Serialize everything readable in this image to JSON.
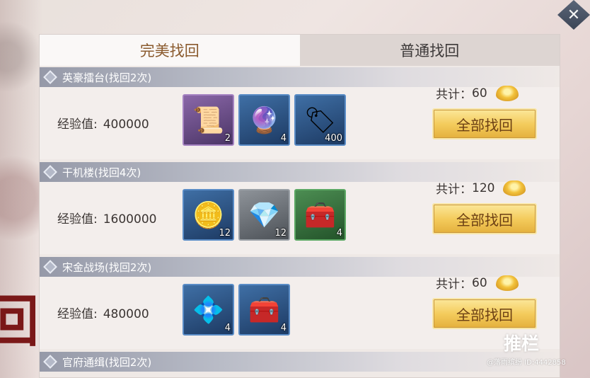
{
  "background_char": "回",
  "tabs": [
    {
      "label": "完美找回",
      "active": true
    },
    {
      "label": "普通找回",
      "active": false
    }
  ],
  "exp_label": "经验值:",
  "total_label": "共计：",
  "recover_button_label": "全部找回",
  "sections": [
    {
      "title": "英豪擂台",
      "count": "(找回2次)",
      "exp": "400000",
      "total": "60",
      "items": [
        {
          "icon": "scroll-icon",
          "glyph": "📜",
          "qty": "2",
          "rarity": "purple"
        },
        {
          "icon": "crystal-ball-icon",
          "glyph": "🔮",
          "qty": "4",
          "rarity": "blue"
        },
        {
          "icon": "token-icon",
          "glyph": "🏷",
          "qty": "400",
          "rarity": "blue"
        }
      ]
    },
    {
      "title": "干机楼",
      "count": "(找回4次)",
      "exp": "1600000",
      "total": "120",
      "items": [
        {
          "icon": "silver-ingot-icon",
          "glyph": "🪙",
          "qty": "12",
          "rarity": "blue"
        },
        {
          "icon": "crystal-shard-icon",
          "glyph": "💎",
          "qty": "12",
          "rarity": "gray"
        },
        {
          "icon": "treasure-chest-icon",
          "glyph": "🧰",
          "qty": "4",
          "rarity": "green"
        }
      ]
    },
    {
      "title": "宋金战场",
      "count": "(找回2次)",
      "exp": "480000",
      "total": "60",
      "items": [
        {
          "icon": "blue-gem-icon",
          "glyph": "💠",
          "qty": "4",
          "rarity": "blue"
        },
        {
          "icon": "jade-chest-icon",
          "glyph": "🧰",
          "qty": "4",
          "rarity": "blue"
        }
      ]
    },
    {
      "title": "官府通缉",
      "count": "(找回2次)"
    }
  ],
  "watermark": {
    "main": "推栏",
    "sub": "@落雨缤纷 ID:4442858"
  },
  "colors": {
    "tab_active_text": "#8a5a2d",
    "button_text": "#6b3f14",
    "button_gold": "#f4cc5d"
  }
}
